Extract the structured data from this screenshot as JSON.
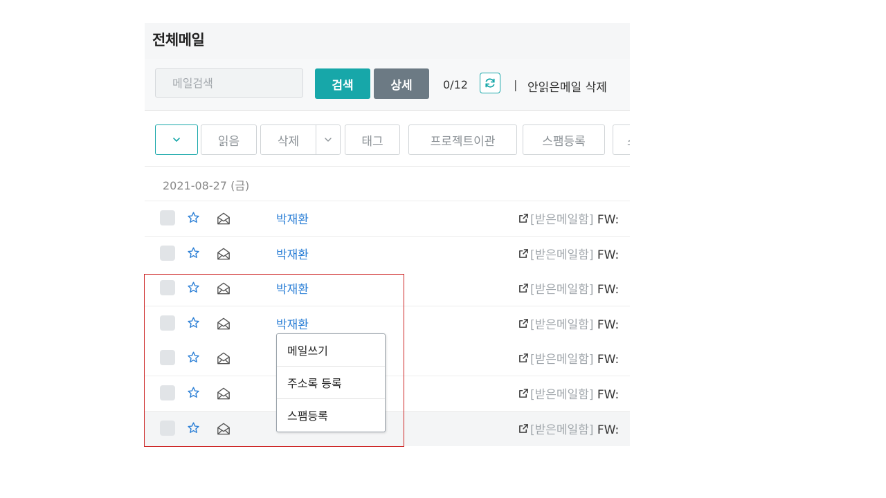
{
  "header": {
    "title": "전체메일"
  },
  "search": {
    "placeholder": "메일검색",
    "search_label": "검색",
    "detail_label": "상세",
    "count": "0/12",
    "refresh_icon": "refresh-icon",
    "separator": "|",
    "delete_unread_label": "안읽은메일 삭제"
  },
  "toolbar": {
    "select_icon": "chevron-down-icon",
    "read_label": "읽음",
    "delete_label": "삭제",
    "tag_label": "태그",
    "project_label": "프로젝트이관",
    "spam_label": "스팸등록",
    "more_label": "스"
  },
  "date_group": "2021-08-27 (금)",
  "mails": [
    {
      "sender": "박재환",
      "folder": "[받은메일함]",
      "subject": "FW:"
    },
    {
      "sender": "박재환",
      "folder": "[받은메일함]",
      "subject": "FW:"
    },
    {
      "sender": "박재환",
      "folder": "[받은메일함]",
      "subject": "FW:"
    },
    {
      "sender": "박재환",
      "folder": "[받은메일함]",
      "subject": "FW:"
    },
    {
      "sender": "",
      "folder": "[받은메일함]",
      "subject": "FW:"
    },
    {
      "sender": "",
      "folder": "[받은메일함]",
      "subject": "FW:"
    },
    {
      "sender": "",
      "folder": "[받은메일함]",
      "subject": "FW:"
    }
  ],
  "context_menu": {
    "items": [
      "메일쓰기",
      "주소록 등록",
      "스팸등록"
    ]
  },
  "colors": {
    "accent": "#17a7a9",
    "secondary": "#6c7a84",
    "sender_link": "#2b7fd6",
    "highlight_box": "#cc2222"
  }
}
